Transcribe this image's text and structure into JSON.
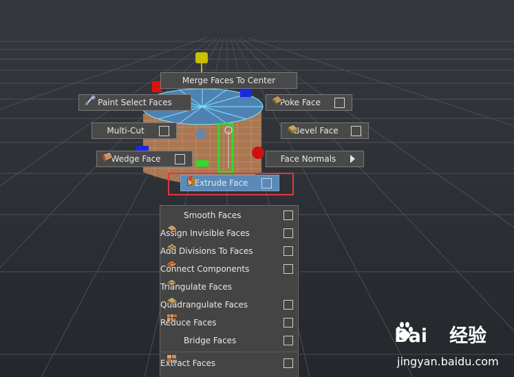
{
  "marking_menu": {
    "north": "Merge Faces To Center",
    "north_west": "Paint Select Faces",
    "north_east": "Poke Face",
    "west": "Multi-Cut",
    "east": "Bevel Face",
    "south_west": "Wedge Face",
    "south_east": "Face Normals",
    "south": "Extrude Face"
  },
  "context_menu": {
    "items": [
      {
        "label": "Smooth Faces",
        "icon": "none",
        "option_box": true
      },
      {
        "label": "Assign Invisible Faces",
        "icon": "assign-invisible-faces-icon",
        "option_box": true
      },
      {
        "label": "Add Divisions To Faces",
        "icon": "add-divisions-icon",
        "option_box": true
      },
      {
        "label": "Connect Components",
        "icon": "connect-components-icon",
        "option_box": true
      },
      {
        "label": "Triangulate Faces",
        "icon": "triangulate-icon",
        "option_box": false
      },
      {
        "label": "Quadrangulate Faces",
        "icon": "quadrangulate-icon",
        "option_box": true
      },
      {
        "label": "Reduce Faces",
        "icon": "reduce-icon",
        "option_box": true
      },
      {
        "label": "Bridge Faces",
        "icon": "none",
        "option_box": true
      },
      {
        "label": "Extract Faces",
        "icon": "extract-icon",
        "option_box": true
      }
    ]
  },
  "watermark": {
    "logo_left": "Bai",
    "logo_right": "经验",
    "url": "jingyan.baidu.com"
  },
  "colors": {
    "viewport_bg": "#2f3338",
    "menu_bg": "#444444",
    "highlight": "#e0393f",
    "selection_blue": "#5a8ab8",
    "wire_cyan": "#7ee9ff",
    "manip_green": "#28e028"
  }
}
